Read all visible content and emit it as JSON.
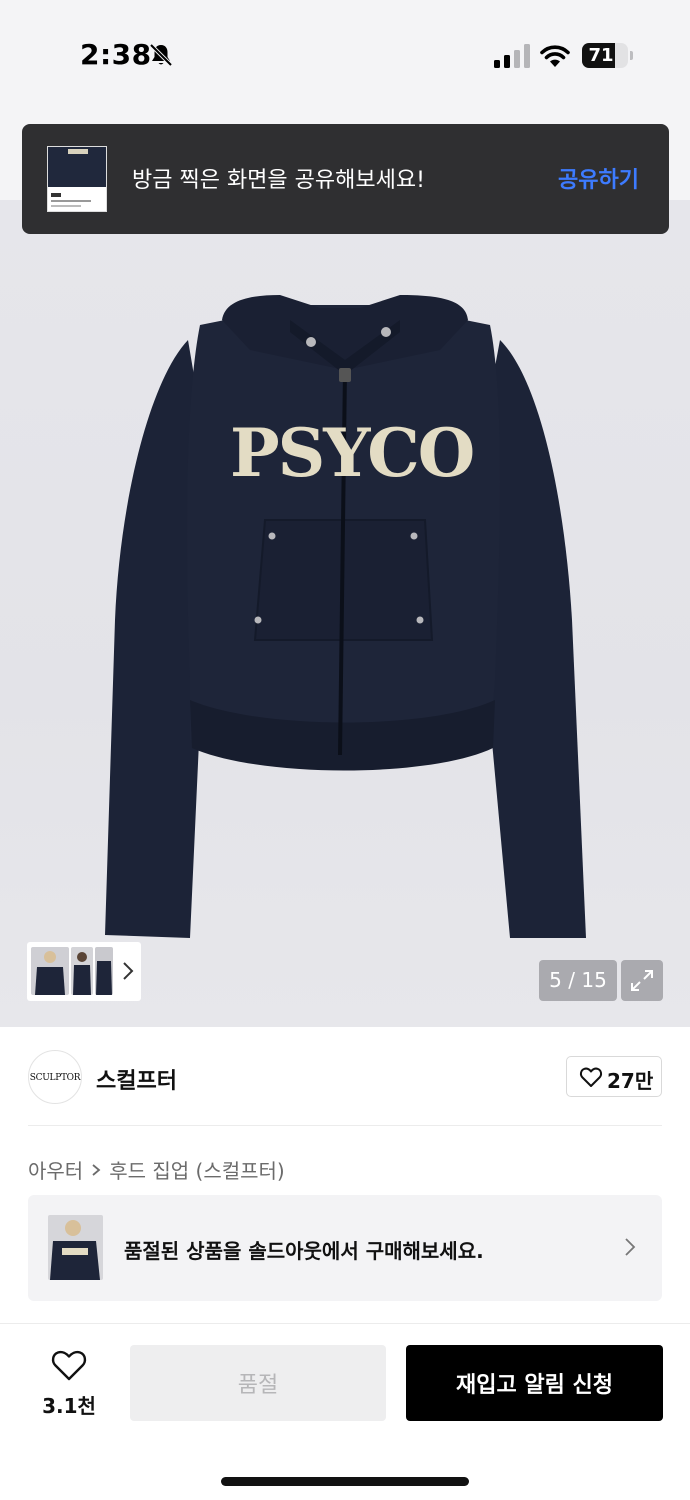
{
  "status_bar": {
    "time": "2:38",
    "battery": "71",
    "battery_level": 0.71
  },
  "toast": {
    "message": "방금 찍은 화면을 공유해보세요!",
    "action": "공유하기"
  },
  "product_image": {
    "graphic_text": "PSYCO",
    "garment_color": "#1d2438",
    "logo_color": "#e3dcc4"
  },
  "gallery": {
    "counter": "5 / 15"
  },
  "brand": {
    "logo_text": "SCULPTOR",
    "name": "스컬프터",
    "likes": "27만"
  },
  "breadcrumb": {
    "category": "아우터",
    "subcategory": "후드 집업 (스컬프터)"
  },
  "soldout_banner": {
    "message": "품절된 상품을 솔드아웃에서 구매해보세요."
  },
  "bottom_bar": {
    "wish_count": "3.1천",
    "soldout_label": "품절",
    "restock_label": "재입고 알림 신청"
  },
  "colors": {
    "accent_blue": "#3d7bff",
    "primary_button": "#000000",
    "disabled_button": "#eeeeef"
  }
}
